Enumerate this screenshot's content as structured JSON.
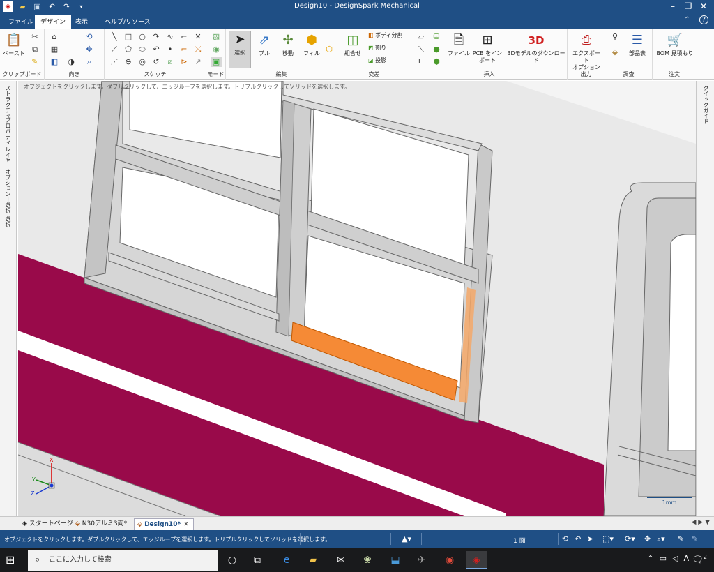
{
  "window": {
    "title": "Design10 - DesignSpark Mechanical",
    "help": "?"
  },
  "ribbon_tabs": [
    "ファイル",
    "デザイン",
    "表示",
    "ヘルプ/リソース"
  ],
  "ribbon": {
    "clipboard": {
      "label": "クリップボード",
      "paste": "ペースト"
    },
    "orient": {
      "label": "向き"
    },
    "sketch": {
      "label": "スケッチ"
    },
    "mode": {
      "label": "モード"
    },
    "edit": {
      "label": "編集",
      "select": "選択",
      "pull": "プル",
      "move": "移動",
      "fill": "フィル"
    },
    "intersect": {
      "label": "交差",
      "combine": "組合せ",
      "split_body": "ボディ分割",
      "split": "割り",
      "project": "投影"
    },
    "insert": {
      "label": "挿入",
      "file": "ファイル",
      "pcb": "PCB をインポート",
      "model_3d": "3Dモデルのダウンロード",
      "badge_3d": "3D"
    },
    "output": {
      "label": "出力",
      "export": "エクスポート",
      "options": "オプション"
    },
    "investigate": {
      "label": "調査",
      "parts": "部品表"
    },
    "order": {
      "label": "注文",
      "bom": "BOM 見積もり"
    }
  },
  "hint_text": "オブジェクトをクリックします。ダブルクリックして、エッジループを選択します。トリプルクリックしてソリッドを選択します。",
  "left_panel_tabs": [
    "ストラクチャー",
    "プロパティ",
    "レイヤ",
    "オプション－選択",
    "選択"
  ],
  "right_panel_tabs": [
    "クイックガイド"
  ],
  "viewport": {
    "scale_label": "1mm",
    "axis_labels": {
      "x": "X",
      "y": "Y",
      "z": "Z"
    },
    "colors": {
      "background": "#e9e9e9",
      "stripe": "#990a4a",
      "highlight": "#f58a36",
      "frame": "#cfcfcf"
    }
  },
  "doc_tabs": [
    {
      "label": "スタートページ",
      "active": false
    },
    {
      "label": "N30アルミ3両*",
      "active": false
    },
    {
      "label": "Design10*",
      "active": true
    }
  ],
  "doc_nav": "◀ ▶ ▼",
  "status": {
    "message": "オブジェクトをクリックします。ダブルクリックして、エッジループを選択します。トリプルクリックしてソリッドを選択します。",
    "body_count": "1 面"
  },
  "taskbar": {
    "search_placeholder": "ここに入力して検索",
    "ime": "A",
    "notifications": "2"
  }
}
